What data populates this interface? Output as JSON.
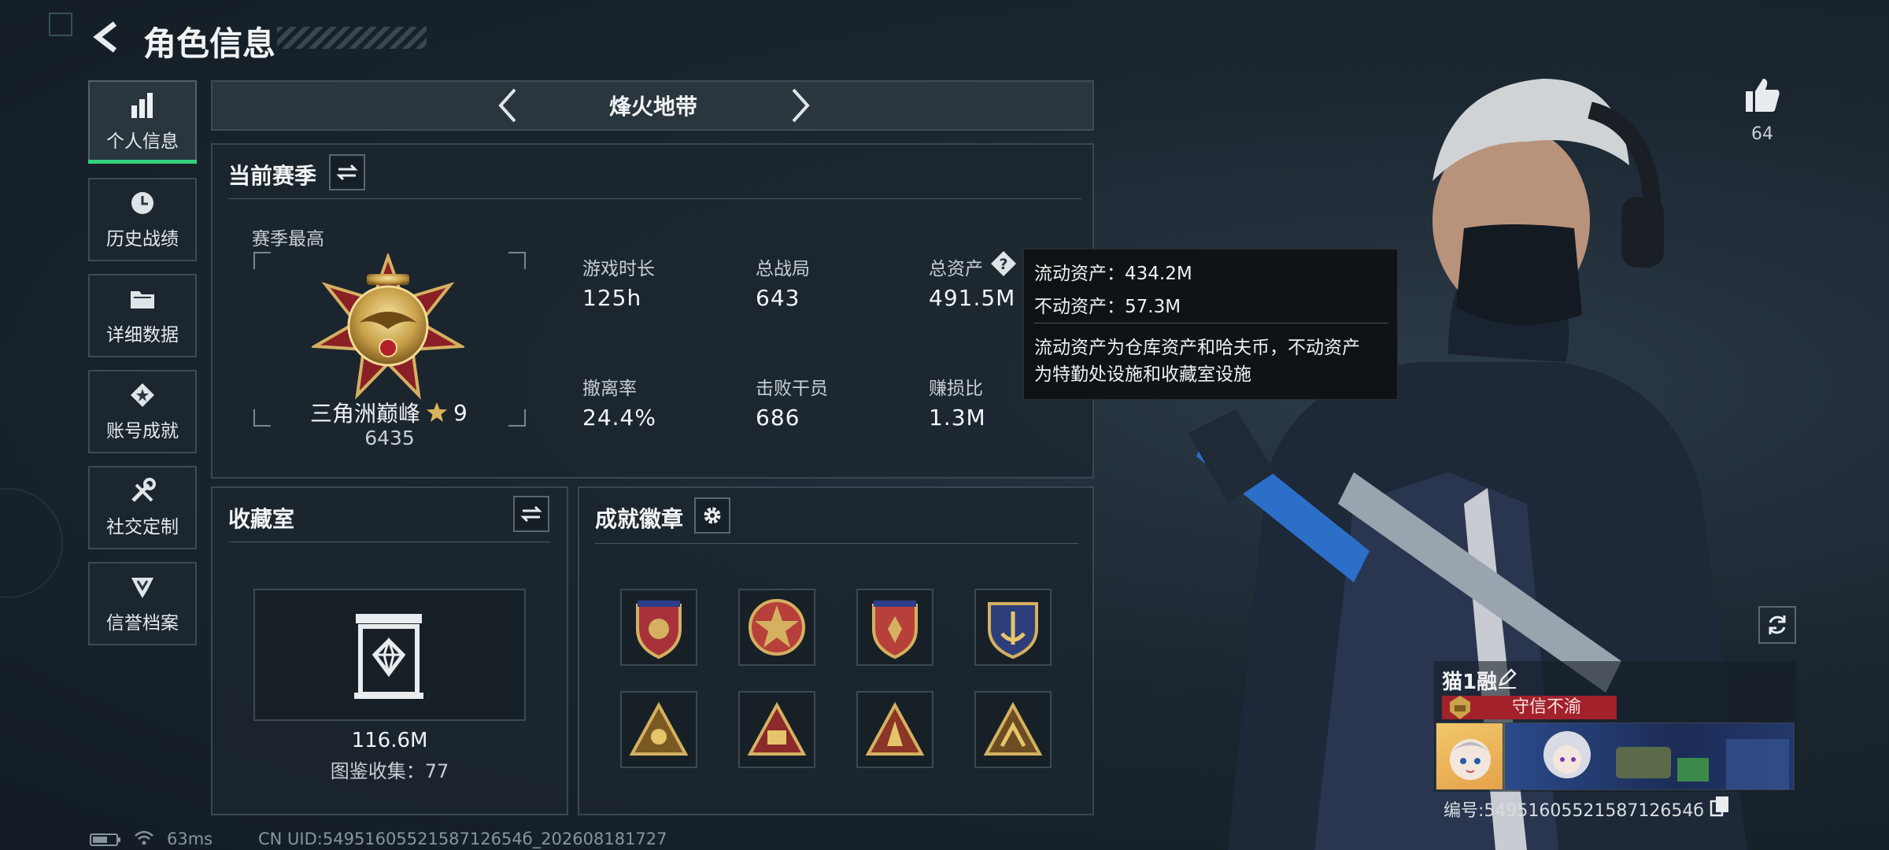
{
  "header": {
    "title": "角色信息"
  },
  "sidebar": {
    "items": [
      {
        "label": "个人信息",
        "icon": "bar-chart-icon",
        "active": true
      },
      {
        "label": "历史战绩",
        "icon": "history-clock-icon",
        "active": false
      },
      {
        "label": "详细数据",
        "icon": "folder-icon",
        "active": false
      },
      {
        "label": "账号成就",
        "icon": "achievement-icon",
        "active": false
      },
      {
        "label": "社交定制",
        "icon": "wrench-icon",
        "active": false
      },
      {
        "label": "信誉档案",
        "icon": "credit-shield-icon",
        "active": false
      }
    ]
  },
  "mode_selector": {
    "label": "烽火地带"
  },
  "season": {
    "title": "当前赛季",
    "best_label": "赛季最高",
    "rank_name": "三角洲巅峰",
    "rank_stars": "9",
    "rank_score": "6435",
    "stats": [
      {
        "label": "游戏时长",
        "value": "125h"
      },
      {
        "label": "总战局",
        "value": "643"
      },
      {
        "label": "总资产",
        "value": "491.5M"
      },
      {
        "label": "撤离率",
        "value": "24.4%"
      },
      {
        "label": "击败干员",
        "value": "686"
      },
      {
        "label": "赚损比",
        "value": "1.3M"
      }
    ]
  },
  "tooltip": {
    "liquid": "流动资产：434.2M",
    "fixed": "不动资产：57.3M",
    "desc_line1": "流动资产为仓库资产和哈夫币，不动资产",
    "desc_line2": "为特勤处设施和收藏室设施"
  },
  "collection": {
    "title": "收藏室",
    "value": "116.6M",
    "catalog": "图鉴收集：77"
  },
  "badges": {
    "title": "成就徽章",
    "items": [
      "badge-1",
      "badge-2",
      "badge-3",
      "badge-4",
      "badge-5",
      "badge-6",
      "badge-7",
      "badge-8"
    ]
  },
  "likes": {
    "count": "64"
  },
  "profile": {
    "name": "猫1融",
    "credit_title": "守信不渝",
    "id_text": "编号:5495160552158712654б"
  },
  "status_bar": {
    "ping": "63ms",
    "uid": "CN UID:5495160552158712654б_202608181727"
  },
  "colors": {
    "accent_green": "#33d17a",
    "credit_red": "#a3212a",
    "gold": "#c9a24a"
  }
}
